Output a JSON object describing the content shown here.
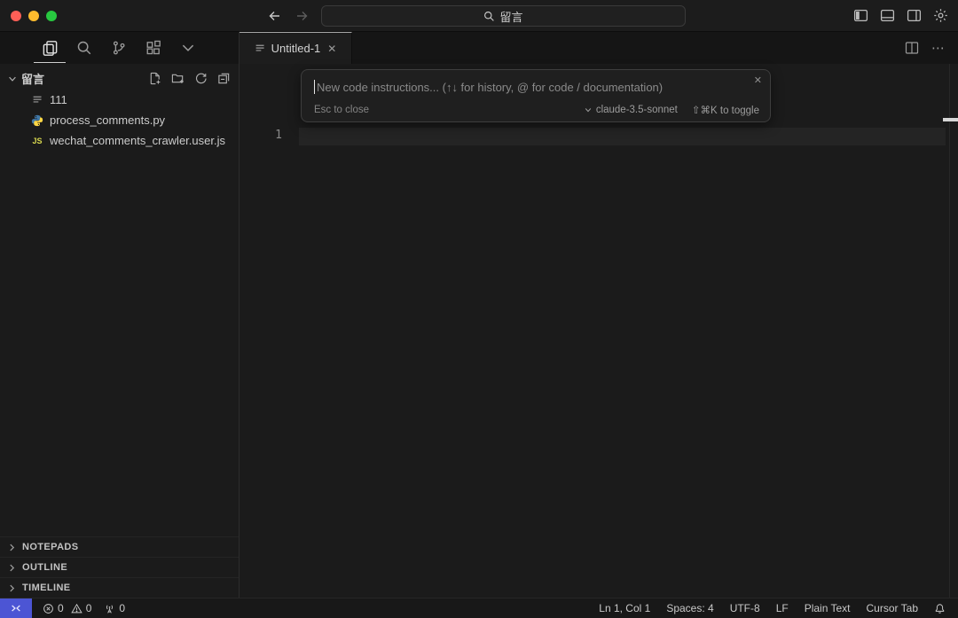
{
  "titlebar": {
    "search_query": "留言",
    "traffic_colors": {
      "close": "#ff5f57",
      "minimize": "#febc2e",
      "zoom": "#28c840"
    }
  },
  "tab": {
    "label": "Untitled-1",
    "close_glyph": "✕",
    "more_glyph": "⋯"
  },
  "explorer": {
    "root_label": "留言",
    "files": [
      {
        "name": "111",
        "type": "text"
      },
      {
        "name": "process_comments.py",
        "type": "python"
      },
      {
        "name": "wechat_comments_crawler.user.js",
        "type": "javascript",
        "badge": "JS"
      }
    ],
    "sections": [
      {
        "label": "NOTEPADS"
      },
      {
        "label": "OUTLINE"
      },
      {
        "label": "TIMELINE"
      }
    ]
  },
  "editor": {
    "line_number": "1",
    "prompt": {
      "placeholder": "New code instructions... (↑↓ for history, @ for code / documentation)",
      "esc_hint": "Esc to close",
      "model": "claude-3.5-sonnet",
      "toggle_hint": "⇧⌘K to toggle",
      "close_glyph": "✕"
    }
  },
  "statusbar": {
    "errors": "0",
    "warnings": "0",
    "ports": "0",
    "cursor_position": "Ln 1, Col 1",
    "indentation": "Spaces: 4",
    "encoding": "UTF-8",
    "eol": "LF",
    "language": "Plain Text",
    "cursor_tab": "Cursor Tab"
  },
  "colors": {
    "remote_button": "#4c55d4",
    "tab_active_border_top": "#a8a8a8",
    "python_blue": "#4078a8",
    "python_yellow": "#ffd845",
    "js_yellow": "#d8d84f"
  }
}
